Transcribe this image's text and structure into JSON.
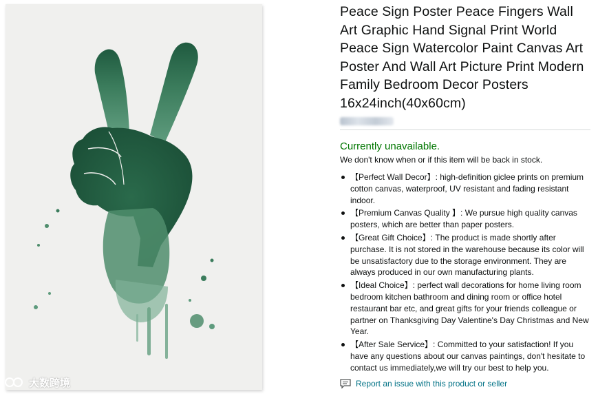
{
  "product": {
    "title": "Peace Sign Poster Peace Fingers Wall Art Graphic Hand Signal Print World Peace Sign Watercolor Paint Canvas Art Poster And Wall Art Picture Print Modern Family Bedroom Decor Posters 16x24inch(40x60cm)",
    "image_alt": "Green watercolor peace sign hand"
  },
  "availability": {
    "status": "Currently unavailable.",
    "note": "We don't know when or if this item will be back in stock."
  },
  "features": [
    "【Perfect Wall Decor】: high-definition giclee prints on premium cotton canvas, waterproof, UV resistant and fading resistant indoor.",
    "【Premium Canvas Quality 】: We pursue high quality canvas posters, which are better than paper posters.",
    "【Great Gift Choice】: The product is made shortly after purchase. It is not stored in the warehouse because its color will be unsatisfactory due to the storage environment. They are always produced in our own manufacturing plants.",
    "【Ideal Choice】: perfect wall decorations for home living room bedroom kitchen bathroom and dining room or office hotel restaurant bar etc, and great gifts for your friends colleague or partner on Thanksgiving Day Valentine's Day Christmas and New Year.",
    "【After Sale Service】: Committed to your satisfaction! If you have any questions about our canvas paintings, don't hesitate to contact us immediately,we will try our best to help you."
  ],
  "report_link": "Report an issue with this product or seller",
  "watermark": "大数跨境",
  "colors": {
    "availability_green": "#007600",
    "link_teal": "#007185",
    "paint_green": "#2f6b4f"
  },
  "icons": [
    "watermark-logo-icon",
    "report-issue-icon"
  ]
}
